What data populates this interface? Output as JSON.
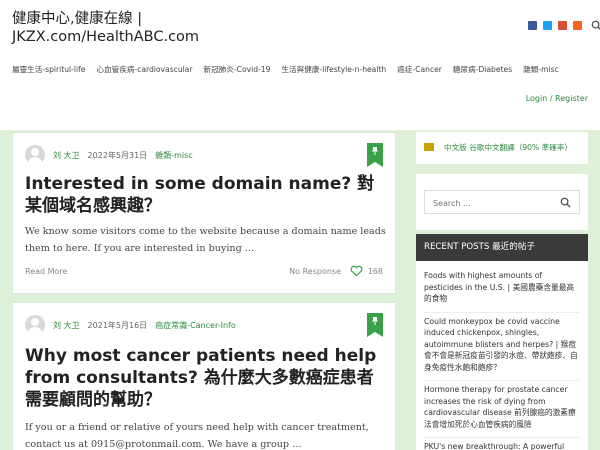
{
  "site": {
    "title": "健康中心,健康在線 | JKZX.com/HealthABC.com"
  },
  "social": [
    {
      "name": "facebook-icon",
      "color": "#3b5998"
    },
    {
      "name": "twitter-icon",
      "color": "#1da1f2"
    },
    {
      "name": "google-plus-icon",
      "color": "#dd4b39"
    },
    {
      "name": "rss-icon",
      "color": "#f26522"
    }
  ],
  "nav": [
    "屬靈生活-spiritul-life",
    "心血管疾病-cardiovascular",
    "新冠肺炎-Covid-19",
    "生活與健康-lifestyle-n-health",
    "癌症-Cancer",
    "糖尿病-Diabetes",
    "雜類-misc"
  ],
  "login": "Login / Register",
  "posts": [
    {
      "author": "刘 大卫",
      "date": "2022年5月31日",
      "category": "雜類-misc",
      "title": "Interested in some domain name? 對某個域名感興趣？",
      "excerpt": "We know some visitors come to the website because a domain name leads them to here.  If you are interested in buying …",
      "read_more": "Read More",
      "responses": "No Response",
      "likes": "168"
    },
    {
      "author": "刘 大卫",
      "date": "2021年5月16日",
      "category": "癌症常識-Cancer-Info",
      "title": "Why most cancer patients need help from consultants? 為什麼大多數癌症患者需要顧問的幫助？",
      "excerpt": "If you or a friend or relative of yours need help with cancer treatment, contact us at 0915@protonmail.com. We have a group …"
    }
  ],
  "sidebar": {
    "translate": "中文版 谷歌中文翻譯（90% 準確率）",
    "search_placeholder": "Search ...",
    "recent_title": "RECENT POSTS 最近的帖子",
    "recent": [
      "Foods with highest amounts of pesticides in the U.S. | 美國農藥含量最高的食物",
      "Could monkeypox be covid vaccine induced chickenpox, shingles, autoimmune blisters and herpes? | 猴痘會不會是新冠疫苗引發的水痘、帶狀皰疹、自身免疫性水皰和皰疹？",
      "Hormone therapy for prostate cancer increases the risk of dying from cardiovascular disease 前列腺癌的激素療法會增加死於心血管疾病的風險",
      "PKU's new breakthrough: A powerful"
    ]
  },
  "colors": {
    "accent": "#2e8a3f",
    "pin": "#3aa14a",
    "content_bg": "#dff0d8",
    "sidebar_header": "#3a3a3a"
  }
}
